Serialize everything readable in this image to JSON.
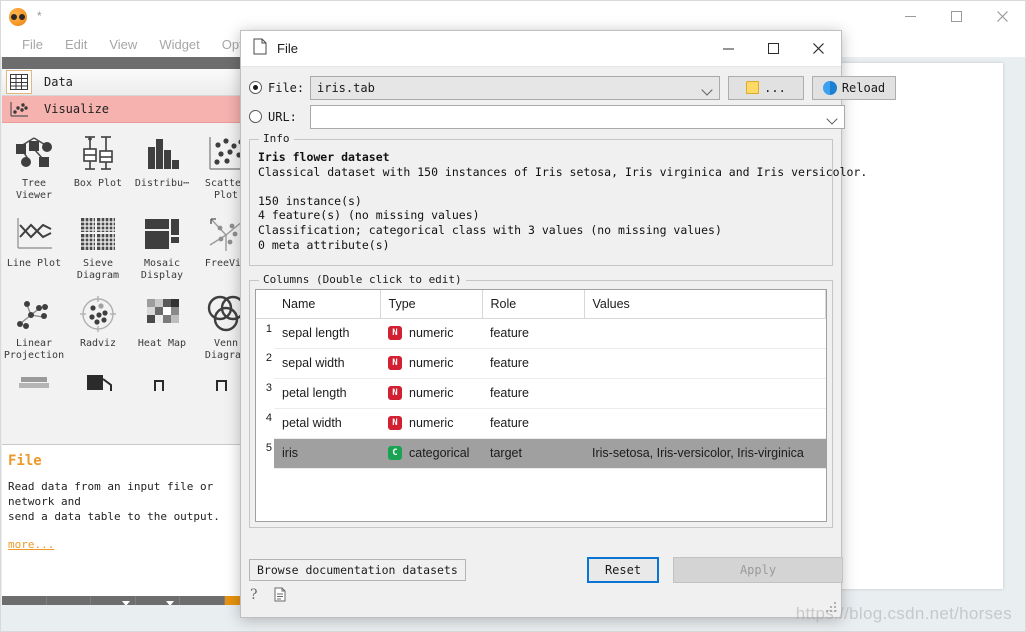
{
  "main_window": {
    "title_star": "*",
    "logo_icon": "orange-logo-icon",
    "menu": [
      "File",
      "Edit",
      "View",
      "Widget",
      "Options"
    ],
    "window_controls": [
      {
        "name": "minimize",
        "glyph": "–"
      },
      {
        "name": "maximize",
        "glyph": "□"
      },
      {
        "name": "close",
        "glyph": "✕"
      }
    ]
  },
  "toolbox": {
    "categories": [
      {
        "label": "Data",
        "icon": "table-grid-icon",
        "selected": false
      },
      {
        "label": "Visualize",
        "icon": "scatter-plot-icon",
        "selected": true
      }
    ],
    "widgets": [
      {
        "label": "Tree\nViewer",
        "icon": "tree-viewer-icon"
      },
      {
        "label": "Box Plot",
        "icon": "box-plot-icon"
      },
      {
        "label": "Distribu⋯",
        "icon": "distributions-icon"
      },
      {
        "label": "Scatter\nPlot",
        "icon": "scatter-plot-icon"
      },
      {
        "label": "Line Plot",
        "icon": "line-plot-icon"
      },
      {
        "label": "Sieve\nDiagram",
        "icon": "sieve-diagram-icon"
      },
      {
        "label": "Mosaic\nDisplay",
        "icon": "mosaic-display-icon"
      },
      {
        "label": "FreeVi⋯",
        "icon": "freeviz-icon"
      },
      {
        "label": "Linear\nProjection",
        "icon": "linear-projection-icon"
      },
      {
        "label": "Radviz",
        "icon": "radviz-icon"
      },
      {
        "label": "Heat Map",
        "icon": "heat-map-icon"
      },
      {
        "label": "Venn\nDiagram",
        "icon": "venn-diagram-icon"
      }
    ],
    "help": {
      "title": "File",
      "description": "Read data from an input file or network and\nsend a data table to the output.",
      "more_link": "more..."
    },
    "bottom_toolbar": [
      {
        "name": "info-button",
        "glyph": "i"
      },
      {
        "name": "grid-button",
        "glyph": "#"
      },
      {
        "name": "text-button",
        "glyph": "T",
        "has_caret": true
      },
      {
        "name": "arrow-button",
        "glyph": "↘",
        "has_caret": true
      },
      {
        "name": "pause-button",
        "glyph": "‖"
      }
    ]
  },
  "dialog": {
    "title": "File",
    "title_icon": "document-icon",
    "window_controls": [
      {
        "name": "minimize",
        "glyph": "–"
      },
      {
        "name": "maximize",
        "glyph": "□"
      },
      {
        "name": "close",
        "glyph": "✕"
      }
    ],
    "source": {
      "file_label": "File:",
      "file_value": "iris.tab",
      "file_selected": true,
      "url_label": "URL:",
      "url_value": "",
      "url_selected": false,
      "browse_label": "...",
      "browse_icon": "folder-icon",
      "reload_label": "Reload",
      "reload_icon": "reload-icon"
    },
    "info": {
      "group_title": "Info",
      "heading": "Iris flower dataset",
      "line1": "Classical dataset with 150 instances of Iris setosa, Iris virginica and Iris versicolor.",
      "line2": "",
      "line3": "150 instance(s)",
      "line4": "4 feature(s) (no missing values)",
      "line5": "Classification; categorical class with 3 values (no missing values)",
      "line6": "0 meta attribute(s)"
    },
    "columns": {
      "group_title": "Columns (Double click to edit)",
      "headers": [
        "Name",
        "Type",
        "Role",
        "Values"
      ],
      "rows": [
        {
          "index": "1",
          "name": "sepal length",
          "type": "numeric",
          "type_badge": "N",
          "role": "feature",
          "values": "",
          "selected": false
        },
        {
          "index": "2",
          "name": "sepal width",
          "type": "numeric",
          "type_badge": "N",
          "role": "feature",
          "values": "",
          "selected": false
        },
        {
          "index": "3",
          "name": "petal length",
          "type": "numeric",
          "type_badge": "N",
          "role": "feature",
          "values": "",
          "selected": false
        },
        {
          "index": "4",
          "name": "petal width",
          "type": "numeric",
          "type_badge": "N",
          "role": "feature",
          "values": "",
          "selected": false
        },
        {
          "index": "5",
          "name": "iris",
          "type": "categorical",
          "type_badge": "C",
          "role": "target",
          "values": "Iris-setosa, Iris-versicolor, Iris-virginica",
          "selected": true
        }
      ]
    },
    "footer": {
      "browse_docs_label": "Browse documentation datasets",
      "reset_label": "Reset",
      "apply_label": "Apply",
      "apply_disabled": true,
      "help_icon": "question-mark-icon",
      "report_icon": "report-document-icon"
    }
  },
  "watermark": "https://blog.csdn.net/horses",
  "colors": {
    "accent_orange": "#e8920f",
    "visualize_highlight": "#f6b2ae",
    "numeric_badge": "#d31f32",
    "categorical_badge": "#1aa353",
    "focus_blue": "#0a74d2",
    "selection_gray": "#a0a0a0"
  }
}
